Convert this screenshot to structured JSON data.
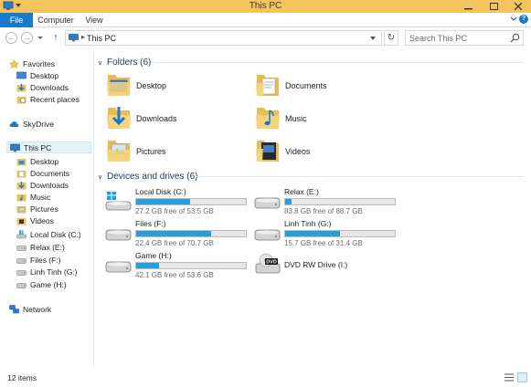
{
  "window": {
    "title": "This PC"
  },
  "ribbon": {
    "tabs": [
      "File",
      "Computer",
      "View"
    ]
  },
  "address": {
    "location": "This PC",
    "search_placeholder": "Search This PC"
  },
  "nav": {
    "favorites": {
      "label": "Favorites",
      "items": [
        "Desktop",
        "Downloads",
        "Recent places"
      ]
    },
    "skydrive": "SkyDrive",
    "this_pc": {
      "label": "This PC",
      "items": [
        "Desktop",
        "Documents",
        "Downloads",
        "Music",
        "Pictures",
        "Videos",
        "Local Disk (C:)",
        "Relax (E:)",
        "Files (F:)",
        "Linh Tinh (G:)",
        "Game (H:)"
      ]
    },
    "network": "Network"
  },
  "folders": {
    "header": "Folders (6)",
    "items": [
      {
        "name": "Desktop",
        "icon": "desktop-folder-icon"
      },
      {
        "name": "Documents",
        "icon": "documents-folder-icon"
      },
      {
        "name": "Downloads",
        "icon": "downloads-folder-icon"
      },
      {
        "name": "Music",
        "icon": "music-folder-icon"
      },
      {
        "name": "Pictures",
        "icon": "pictures-folder-icon"
      },
      {
        "name": "Videos",
        "icon": "videos-folder-icon"
      }
    ]
  },
  "drives": {
    "header": "Devices and drives (6)",
    "items": [
      {
        "name": "Local Disk (C:)",
        "free": "27.2 GB free of 53.5 GB",
        "used_fraction": 0.49
      },
      {
        "name": "Relax (E:)",
        "free": "83.8 GB free of 88.7 GB",
        "used_fraction": 0.06
      },
      {
        "name": "Files (F:)",
        "free": "22.4 GB free of 70.7 GB",
        "used_fraction": 0.68
      },
      {
        "name": "Linh Tinh (G:)",
        "free": "15.7 GB free of 31.4 GB",
        "used_fraction": 0.5
      },
      {
        "name": "Game (H:)",
        "free": "42.1 GB free of 53.6 GB",
        "used_fraction": 0.21
      },
      {
        "name": "DVD RW Drive (I:)",
        "free": "",
        "used_fraction": null
      }
    ]
  },
  "status": {
    "item_count": "12 items"
  },
  "colors": {
    "accent": "#1979ca",
    "bar_fill": "#26a0da",
    "title_bar": "#f2c45b"
  }
}
